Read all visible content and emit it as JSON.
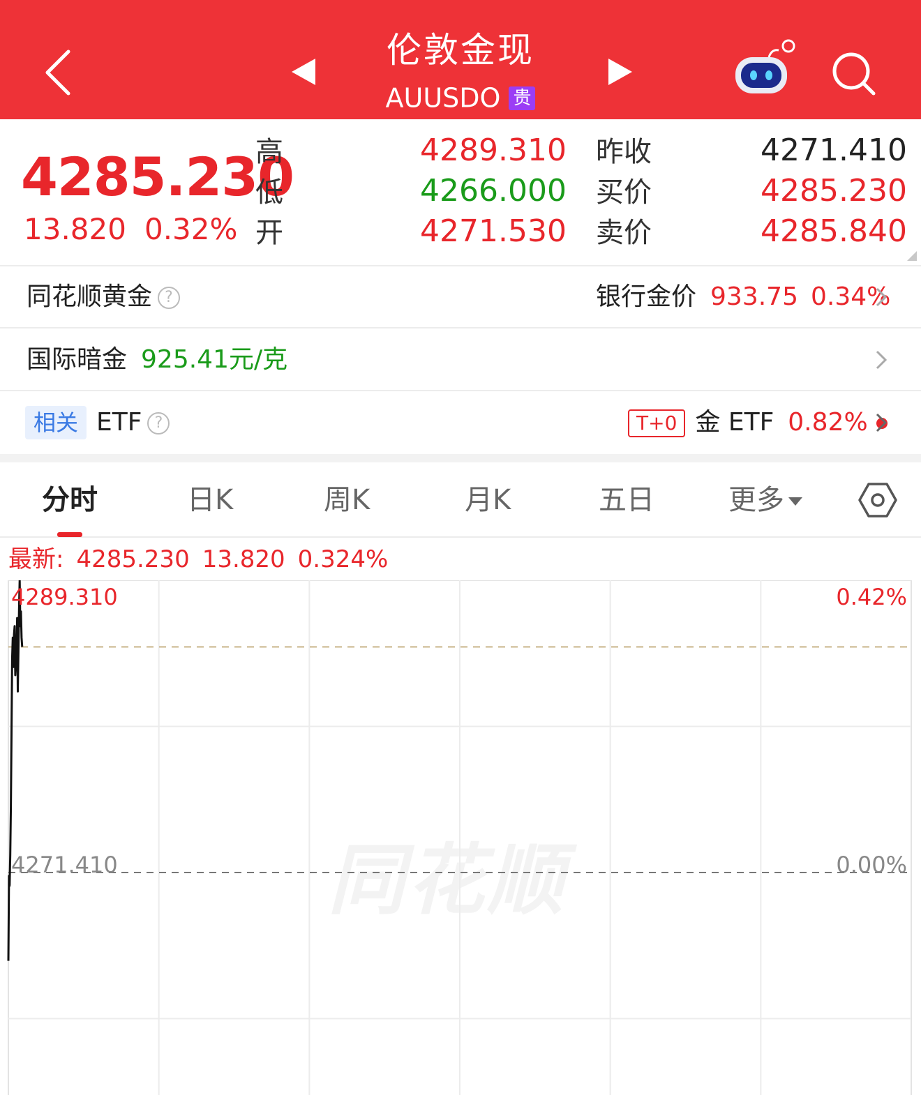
{
  "header": {
    "title": "伦敦金现",
    "code": "AUUSDO",
    "badge": "贵"
  },
  "quote": {
    "last": "4285.230",
    "change": "13.820",
    "change_pct": "0.32%",
    "labels": {
      "high": "高",
      "low": "低",
      "open": "开",
      "prev_close": "昨收",
      "bid": "买价",
      "ask": "卖价"
    },
    "high": "4289.310",
    "low": "4266.000",
    "open": "4271.530",
    "prev_close": "4271.410",
    "bid": "4285.230",
    "ask": "4285.840"
  },
  "rows": {
    "ths_gold": {
      "label": "同花顺黄金",
      "help": "?",
      "bank_label": "银行金价",
      "bank_price": "933.75",
      "bank_pct": "0.34%"
    },
    "dark_gold": {
      "label": "国际暗金",
      "value": "925.41元/克"
    },
    "etf": {
      "tag": "相关",
      "label": "ETF",
      "help": "?",
      "t0": "T+0",
      "name": "金 ETF",
      "pct": "0.82%"
    }
  },
  "tabs": [
    {
      "label": "分时"
    },
    {
      "label": "日K"
    },
    {
      "label": "周K"
    },
    {
      "label": "月K"
    },
    {
      "label": "五日"
    },
    {
      "label": "更多"
    }
  ],
  "latest": {
    "prefix": "最新:",
    "price": "4285.230",
    "change": "13.820",
    "pct": "0.324%"
  },
  "colors": {
    "accent": "#ee3237",
    "up": "#e8262b",
    "down": "#1a9b1a"
  },
  "chart_data": {
    "type": "line",
    "y_left_max": "4289.310",
    "y_left_mid": "4271.410",
    "y_right_max": "0.42%",
    "y_right_mid": "0.00%",
    "watermark": "同花顺",
    "ylim": [
      4253.51,
      4289.31
    ],
    "prev_close": 4271.41,
    "reference_line": 4285.23,
    "x": [
      0,
      1,
      2,
      3,
      4,
      5,
      6,
      7,
      8,
      9,
      10,
      11,
      12,
      13,
      14,
      15,
      16,
      17,
      18,
      19,
      20,
      21,
      22
    ],
    "values": [
      4266.0,
      4271.2,
      4270.6,
      4272.5,
      4275.5,
      4280.0,
      4284.5,
      4285.8,
      4284.0,
      4286.0,
      4286.5,
      4283.5,
      4284.2,
      4284.8,
      4287.0,
      4282.5,
      4285.0,
      4287.5,
      4289.31,
      4286.5,
      4287.4,
      4285.8,
      4285.23
    ]
  }
}
